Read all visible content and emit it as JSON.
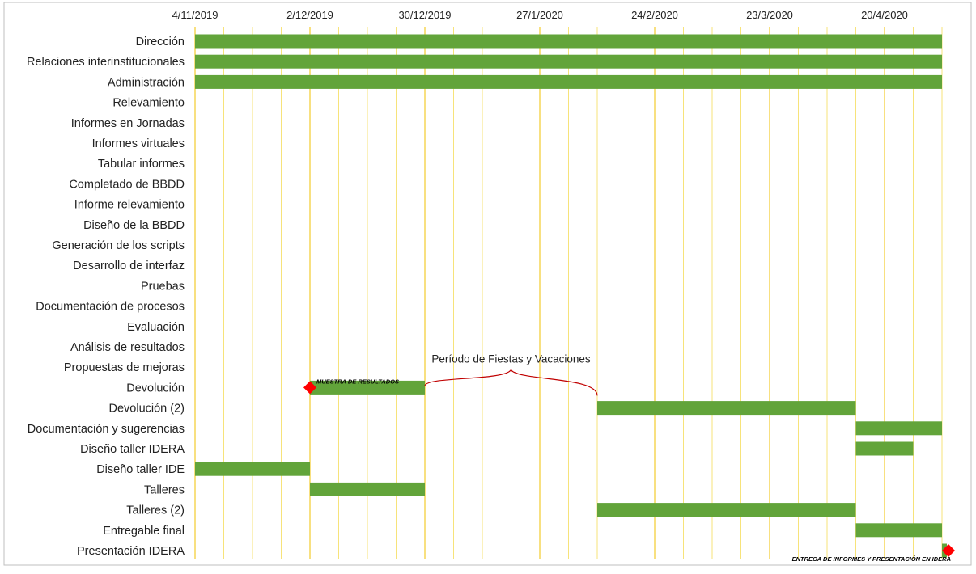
{
  "chart_data": {
    "type": "gantt",
    "title": "",
    "x_axis": {
      "type": "date",
      "min": "2019-11-04",
      "max": "2020-05-04",
      "tick_labels": [
        "4/11/2019",
        "2/12/2019",
        "30/12/2019",
        "27/1/2020",
        "24/2/2020",
        "23/3/2020",
        "20/4/2020"
      ],
      "tick_dates": [
        "2019-11-04",
        "2019-12-02",
        "2019-12-30",
        "2020-01-27",
        "2020-02-24",
        "2020-03-23",
        "2020-04-20"
      ],
      "gridline_interval_days": 7,
      "gridline_colors": {
        "major": "#f0c000",
        "minor": "#f7e37a"
      }
    },
    "tasks": [
      {
        "name": "Dirección",
        "start": "2019-11-04",
        "end": "2020-05-04"
      },
      {
        "name": "Relaciones interinstitucionales",
        "start": "2019-11-04",
        "end": "2020-05-04"
      },
      {
        "name": "Administración",
        "start": "2019-11-04",
        "end": "2020-05-04"
      },
      {
        "name": "Relevamiento",
        "start": null,
        "end": null
      },
      {
        "name": "Informes en Jornadas",
        "start": null,
        "end": null
      },
      {
        "name": "Informes virtuales",
        "start": null,
        "end": null
      },
      {
        "name": "Tabular informes",
        "start": null,
        "end": null
      },
      {
        "name": "Completado de BBDD",
        "start": null,
        "end": null
      },
      {
        "name": "Informe relevamiento",
        "start": null,
        "end": null
      },
      {
        "name": "Diseño de la BBDD",
        "start": null,
        "end": null
      },
      {
        "name": "Generación de los scripts",
        "start": null,
        "end": null
      },
      {
        "name": "Desarrollo de interfaz",
        "start": null,
        "end": null
      },
      {
        "name": "Pruebas",
        "start": null,
        "end": null
      },
      {
        "name": "Documentación de procesos",
        "start": null,
        "end": null
      },
      {
        "name": "Evaluación",
        "start": null,
        "end": null
      },
      {
        "name": "Análisis de resultados",
        "start": null,
        "end": null
      },
      {
        "name": "Propuestas de mejoras",
        "start": null,
        "end": null
      },
      {
        "name": "Devolución",
        "start": "2019-12-02",
        "end": "2019-12-30"
      },
      {
        "name": "Devolución (2)",
        "start": "2020-02-10",
        "end": "2020-04-13"
      },
      {
        "name": "Documentación y sugerencias",
        "start": "2020-04-13",
        "end": "2020-05-04"
      },
      {
        "name": "Diseño taller IDERA",
        "start": "2020-04-13",
        "end": "2020-04-27"
      },
      {
        "name": "Diseño taller IDE",
        "start": "2019-11-04",
        "end": "2019-12-02"
      },
      {
        "name": "Talleres",
        "start": "2019-12-02",
        "end": "2019-12-30"
      },
      {
        "name": "Talleres (2)",
        "start": "2020-02-10",
        "end": "2020-04-13"
      },
      {
        "name": "Entregable final",
        "start": "2020-04-13",
        "end": "2020-05-04"
      },
      {
        "name": "Presentación IDERA",
        "start": "2020-05-04",
        "end": "2020-05-10"
      }
    ],
    "milestones": [
      {
        "task": "Devolución",
        "date": "2019-12-02",
        "label": "MUESTRA DE RESULTADOS"
      },
      {
        "task": "Presentación IDERA",
        "date": "2020-05-10",
        "label": "ENTREGA DE INFORMES Y PRESENTACIÓN EN IDERA"
      }
    ],
    "annotations": [
      {
        "text": "Período de Fiestas y Vacaciones",
        "type": "brace",
        "start": "2019-12-30",
        "end": "2020-02-10",
        "task": "Devolución"
      }
    ],
    "colors": {
      "bar": "#62a43a",
      "milestone": "#ff0000",
      "brace": "#c00000"
    },
    "grid": true,
    "legend": "none"
  }
}
